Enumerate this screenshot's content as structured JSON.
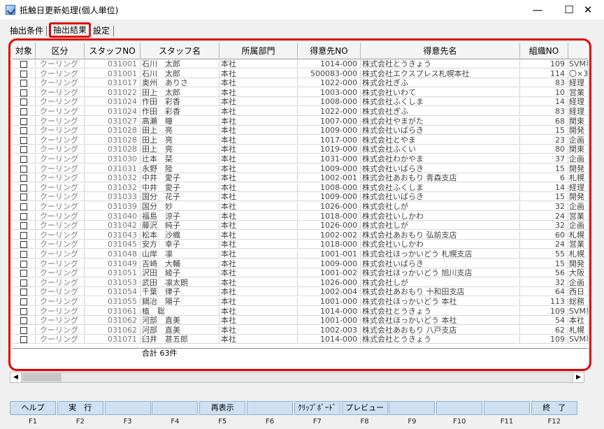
{
  "window": {
    "title": "抵触日更新処理(個人単位)",
    "min": "—",
    "max": "☐",
    "close": "✕"
  },
  "tabs": [
    "抽出条件",
    "抽出結果",
    "設定"
  ],
  "columns": [
    "対象",
    "区分",
    "スタッフNO",
    "スタッフ名",
    "所属部門",
    "得意先NO",
    "得意先名",
    "組織NO",
    ""
  ],
  "rows": [
    [
      "クーリング",
      "031001",
      "石川　太郎",
      "本社",
      "1014-000",
      "株式会社とうきょう",
      "109",
      "SVM事"
    ],
    [
      "クーリング",
      "031001",
      "石川　太郎",
      "本社",
      "500083-000",
      "株式会社エクスプレス札幌本社",
      "114",
      "〇×3"
    ],
    [
      "クーリング",
      "031017",
      "奥州　ありさ",
      "本社",
      "1022-000",
      "株式会社ぎふ",
      "83",
      "経理"
    ],
    [
      "クーリング",
      "031022",
      "田上　太郎",
      "本社",
      "1003-000",
      "株式会社いわて",
      "10",
      "営業"
    ],
    [
      "クーリング",
      "031024",
      "作田　彩香",
      "本社",
      "1008-000",
      "株式会社ふくしま",
      "14",
      "経理"
    ],
    [
      "クーリング",
      "031024",
      "作田　彩香",
      "本社",
      "1022-000",
      "株式会社ぎふ",
      "83",
      "経理"
    ],
    [
      "クーリング",
      "031027",
      "高瀬　瞳",
      "本社",
      "1007-000",
      "株式会社やまがた",
      "68",
      "関東"
    ],
    [
      "クーリング",
      "031028",
      "田上　亮",
      "本社",
      "1009-000",
      "株式会社いばらき",
      "15",
      "開発"
    ],
    [
      "クーリング",
      "031028",
      "田上　亮",
      "本社",
      "1017-000",
      "株式会社とやま",
      "23",
      "企画"
    ],
    [
      "クーリング",
      "031028",
      "田上　亮",
      "本社",
      "1019-000",
      "株式会社ふくい",
      "80",
      "関東"
    ],
    [
      "クーリング",
      "031030",
      "辻本　栞",
      "本社",
      "1031-000",
      "株式会社わかやま",
      "37",
      "企画"
    ],
    [
      "クーリング",
      "031031",
      "永野　陸",
      "本社",
      "1009-000",
      "株式会社いばらき",
      "15",
      "開発"
    ],
    [
      "クーリング",
      "031032",
      "中井　愛子",
      "本社",
      "1002-001",
      "株式会社あおもり 青森支店",
      "6",
      "札幌"
    ],
    [
      "クーリング",
      "031032",
      "中井　愛子",
      "本社",
      "1008-000",
      "株式会社ふくしま",
      "14",
      "経理"
    ],
    [
      "クーリング",
      "031033",
      "国分　花子",
      "本社",
      "1009-000",
      "株式会社いばらき",
      "15",
      "開発"
    ],
    [
      "クーリング",
      "031039",
      "国分　妙",
      "本社",
      "1026-000",
      "株式会社しが",
      "32",
      "企画"
    ],
    [
      "クーリング",
      "031040",
      "福島　涼子",
      "本社",
      "1018-000",
      "株式会社いしかわ",
      "24",
      "営業"
    ],
    [
      "クーリング",
      "031042",
      "藤沢　純子",
      "本社",
      "1026-000",
      "株式会社しが",
      "32",
      "企画"
    ],
    [
      "クーリング",
      "031043",
      "松本　沙織",
      "本社",
      "1002-002",
      "株式会社あおもり 弘前支店",
      "60",
      "札幌"
    ],
    [
      "クーリング",
      "031045",
      "安方　幸子",
      "本社",
      "1018-000",
      "株式会社いしかわ",
      "24",
      "営業"
    ],
    [
      "クーリング",
      "031048",
      "山岸　凛",
      "本社",
      "1001-001",
      "株式会社ほっかいどう 札幌支店",
      "55",
      "札幌"
    ],
    [
      "クーリング",
      "031049",
      "吉崎　大輔",
      "本社",
      "1009-000",
      "株式会社いばらき",
      "15",
      "開発"
    ],
    [
      "クーリング",
      "031051",
      "沢田　綾子",
      "本社",
      "1001-002",
      "株式会社ほっかいどう 旭川支店",
      "56",
      "大阪"
    ],
    [
      "クーリング",
      "031053",
      "武田　凛太朗",
      "本社",
      "1026-000",
      "株式会社しが",
      "32",
      "企画"
    ],
    [
      "クーリング",
      "031054",
      "千葉　律子",
      "本社",
      "1002-004",
      "株式会社あおもり 十和田支店",
      "64",
      "西日"
    ],
    [
      "クーリング",
      "031055",
      "鍋冶　陽子",
      "本社",
      "1001-000",
      "株式会社ほっかいどう 本社",
      "113",
      "総務"
    ],
    [
      "クーリング",
      "031061",
      "植　聡",
      "本社",
      "1014-000",
      "株式会社とうきょう",
      "109",
      "SVM事"
    ],
    [
      "クーリング",
      "031062",
      "河部　直美",
      "本社",
      "1001-000",
      "株式会社ほっかいどう 本社",
      "54",
      "本社"
    ],
    [
      "クーリング",
      "031062",
      "河部　直美",
      "本社",
      "1002-003",
      "株式会社あおもり 八戸支店",
      "62",
      "札幌"
    ],
    [
      "クーリング",
      "031071",
      "臼井　甚五郎",
      "本社",
      "1014-000",
      "株式会社とうきょう",
      "109",
      "SVM事"
    ]
  ],
  "total": "合計 63件",
  "scroll": {
    "left": "◀",
    "right": "▶"
  },
  "fkeys": [
    "ヘルプ",
    "実　行",
    "",
    "",
    "再表示",
    "",
    "ｸﾘｯﾌﾟﾎﾞｰﾄﾞ",
    "プレビュー",
    "",
    "",
    "",
    "終　了"
  ],
  "fkey_labels": [
    "F1",
    "F2",
    "F3",
    "F4",
    "F5",
    "F6",
    "F7",
    "F8",
    "F9",
    "F10",
    "F11",
    "F12"
  ]
}
